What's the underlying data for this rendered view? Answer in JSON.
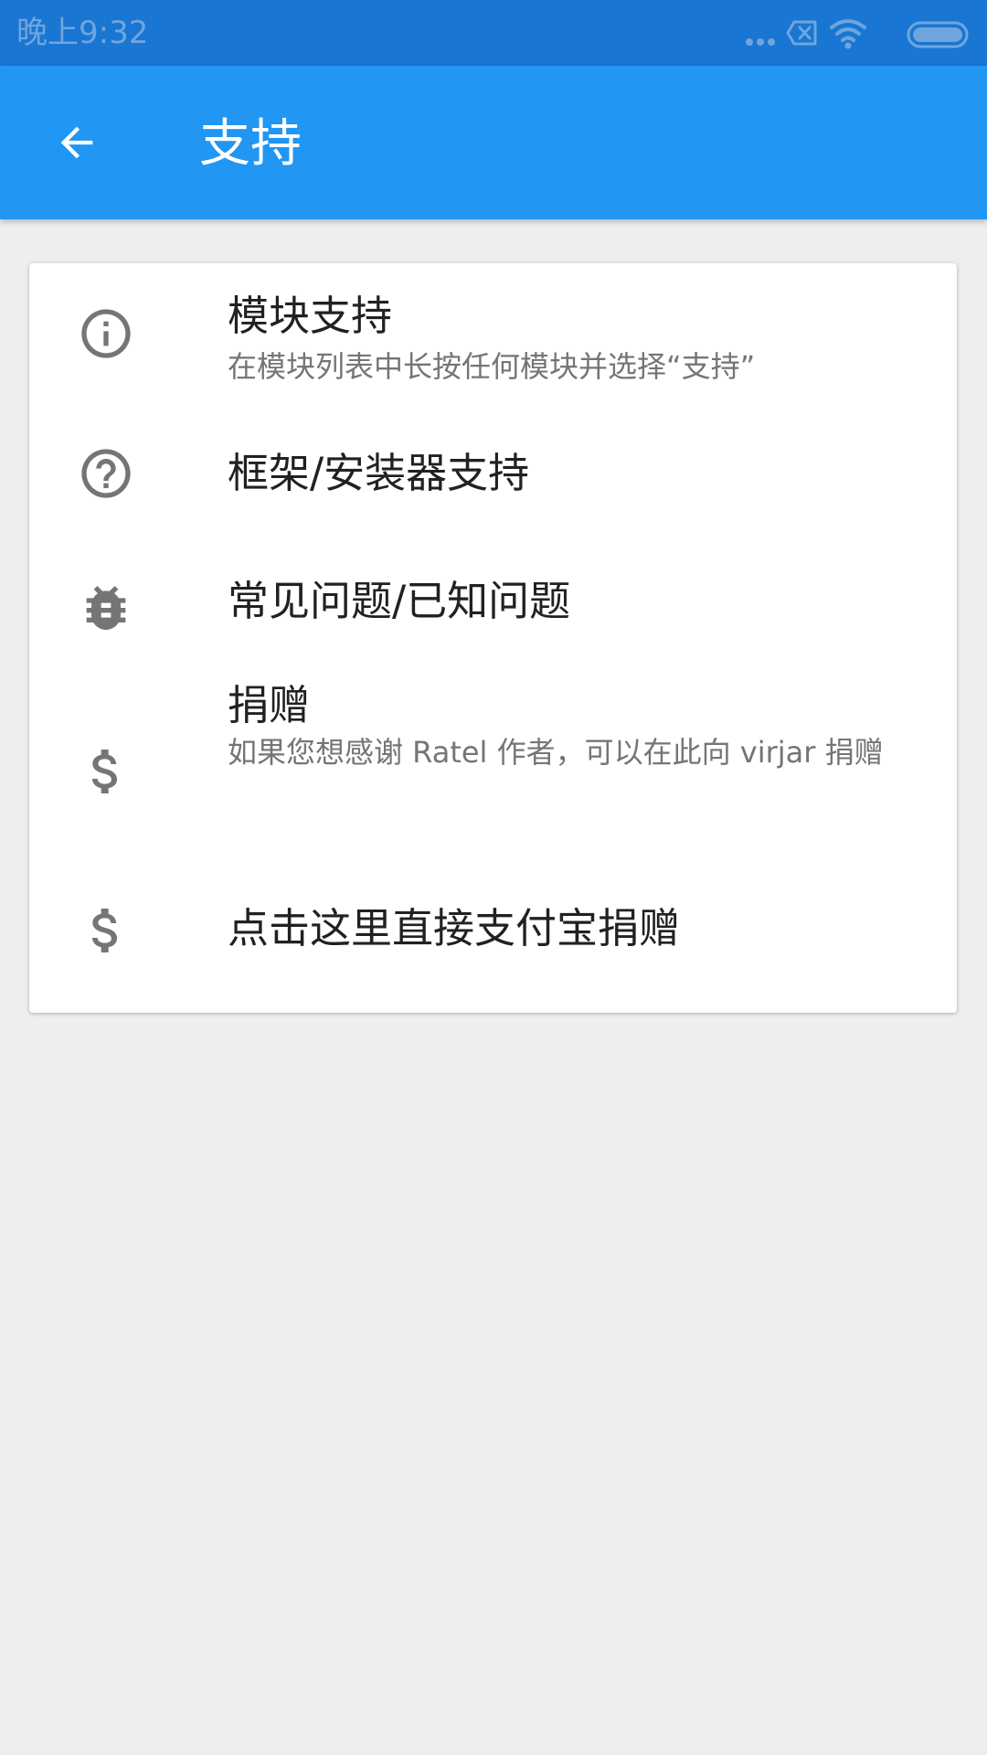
{
  "status_bar": {
    "time": "晚上9:32",
    "icons": [
      "more-dots-icon",
      "notification-off-icon",
      "wifi-icon",
      "battery-icon"
    ],
    "color": "#1976d2"
  },
  "app_bar": {
    "title": "支持",
    "back_icon": "arrow-back-icon",
    "color": "#2196f3"
  },
  "items": [
    {
      "icon": "info-icon",
      "title": "模块支持",
      "subtitle": "在模块列表中长按任何模块并选择“支持”"
    },
    {
      "icon": "help-circle-icon",
      "title": "框架/安装器支持"
    },
    {
      "icon": "bug-icon",
      "title": "常见问题/已知问题"
    },
    {
      "icon": "dollar-icon",
      "title": "捐赠",
      "subtitle": "如果您想感谢 Ratel 作者，可以在此向 virjar 捐赠"
    },
    {
      "icon": "dollar-icon",
      "title": "点击这里直接支付宝捐赠"
    }
  ],
  "colors": {
    "background": "#eeeeee",
    "icon": "#757575",
    "title_text": "#212121",
    "subtitle_text": "#757575"
  }
}
